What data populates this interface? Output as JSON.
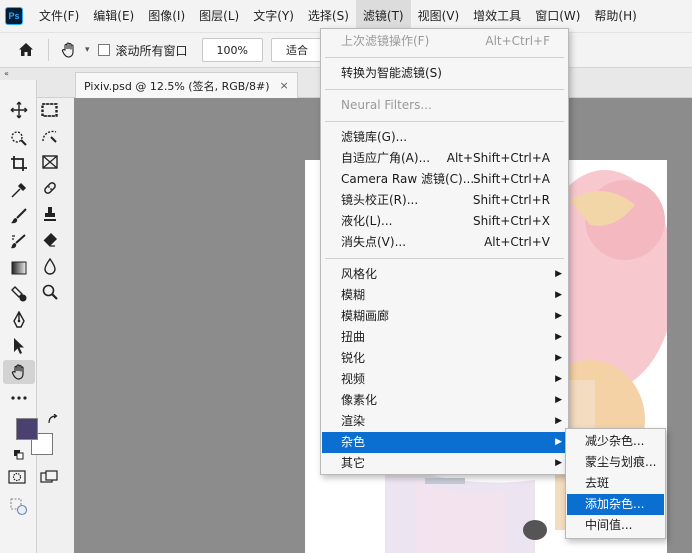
{
  "app": {
    "logo_text": "Ps"
  },
  "menubar": {
    "items": [
      "文件(F)",
      "编辑(E)",
      "图像(I)",
      "图层(L)",
      "文字(Y)",
      "选择(S)",
      "滤镜(T)",
      "视图(V)",
      "增效工具",
      "窗口(W)",
      "帮助(H)"
    ],
    "active_index": 6
  },
  "options_bar": {
    "scroll_all_label": "滚动所有窗口",
    "scroll_all_checked": false,
    "zoom_button": "100%",
    "fit_button": "适合"
  },
  "document": {
    "tab_title": "Pixiv.psd @ 12.5% (签名, RGB/8#)",
    "tab_close": "×",
    "panel_collapse": "«"
  },
  "colors": {
    "foreground": "#4b4170",
    "background": "#ffffff",
    "menu_highlight": "#0a6fd0",
    "canvas_bg": "#8c8c8c"
  },
  "filter_menu": {
    "last_filter": {
      "label": "上次滤镜操作(F)",
      "shortcut": "Alt+Ctrl+F"
    },
    "smart": {
      "label": "转换为智能滤镜(S)"
    },
    "neural": {
      "label": "Neural Filters..."
    },
    "filter_gallery": {
      "label": "滤镜库(G)..."
    },
    "adaptive_wide": {
      "label": "自适应广角(A)...",
      "shortcut": "Alt+Shift+Ctrl+A"
    },
    "camera_raw": {
      "label": "Camera Raw 滤镜(C)...",
      "shortcut": "Shift+Ctrl+A"
    },
    "lens_correction": {
      "label": "镜头校正(R)...",
      "shortcut": "Shift+Ctrl+R"
    },
    "liquify": {
      "label": "液化(L)...",
      "shortcut": "Shift+Ctrl+X"
    },
    "vanishing_point": {
      "label": "消失点(V)...",
      "shortcut": "Alt+Ctrl+V"
    },
    "submenus": [
      "风格化",
      "模糊",
      "模糊画廊",
      "扭曲",
      "锐化",
      "视频",
      "像素化",
      "渲染",
      "杂色",
      "其它"
    ],
    "submenu_arrow": "▶"
  },
  "noise_submenu": {
    "items": [
      "减少杂色...",
      "蒙尘与划痕...",
      "去斑",
      "添加杂色...",
      "中间值..."
    ],
    "highlight_index": 3
  }
}
